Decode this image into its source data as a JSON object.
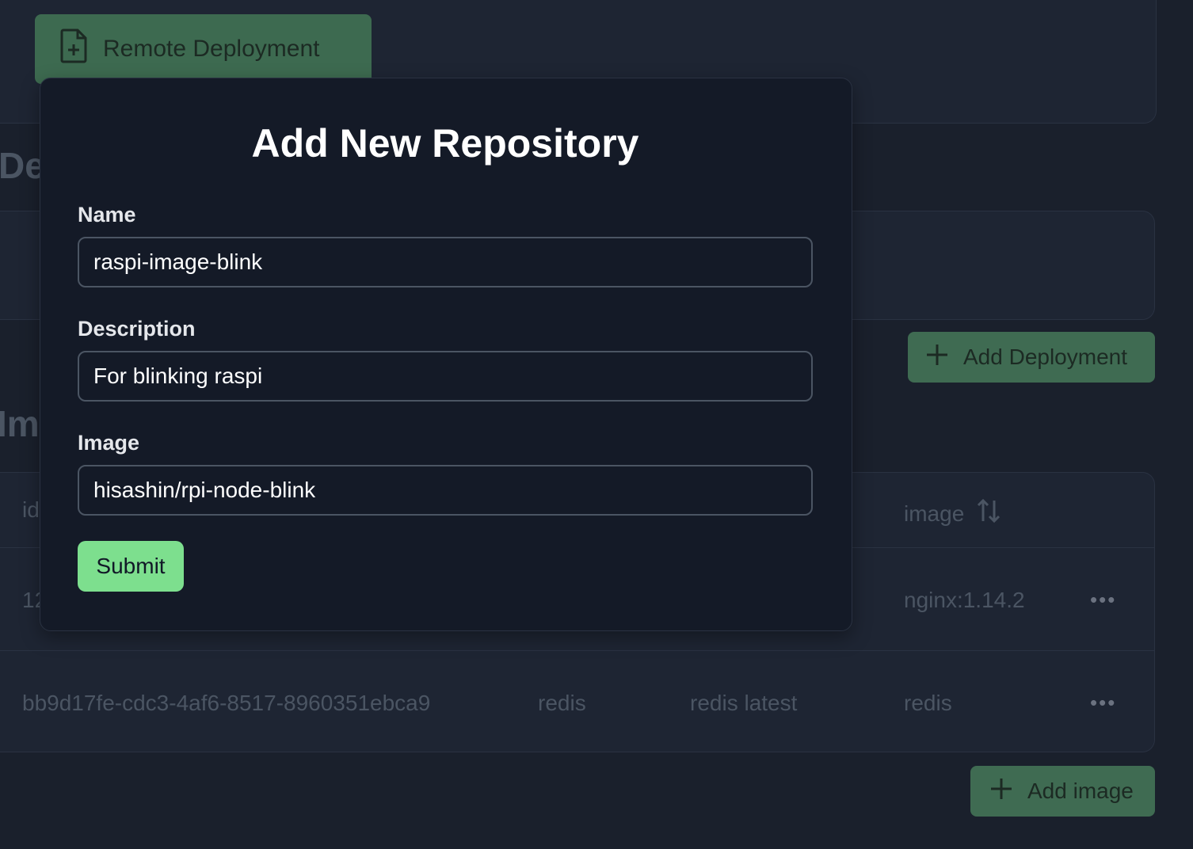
{
  "background": {
    "remote_button_label": "Remote Deployment",
    "deployments_heading": "De",
    "images_heading": "Im",
    "add_deployment_label": "Add Deployment",
    "add_image_label": "Add image",
    "table": {
      "headers": {
        "id": "id",
        "image": "image"
      },
      "rows": [
        {
          "id": "12",
          "image": "nginx:1.14.2"
        },
        {
          "id": "bb9d17fe-cdc3-4af6-8517-8960351ebca9",
          "name": "redis",
          "description": "redis latest",
          "image": "redis"
        }
      ],
      "row_actions": "•••"
    }
  },
  "modal": {
    "title": "Add New Repository",
    "fields": {
      "name": {
        "label": "Name",
        "value": "raspi-image-blink"
      },
      "description": {
        "label": "Description",
        "value": "For blinking raspi"
      },
      "image": {
        "label": "Image",
        "value": "hisashin/rpi-node-blink"
      }
    },
    "submit_label": "Submit"
  },
  "colors": {
    "page_bg": "#1a202c",
    "modal_bg": "#141a27",
    "accent_green": "#7ddf8e",
    "muted_green_button": "#3f6b52"
  },
  "icons": {
    "remote": "file-plus-icon",
    "add": "plus-icon",
    "sort": "sort-arrows-icon",
    "row_menu": "more-horizontal-icon"
  }
}
